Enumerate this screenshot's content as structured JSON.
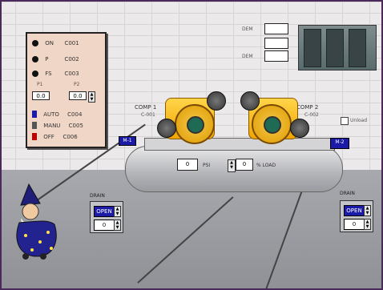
{
  "status_panel": {
    "indicators": [
      {
        "label": "ON",
        "value": "C001"
      },
      {
        "label": "P",
        "value": "C002"
      },
      {
        "label": "FS",
        "value": "C003"
      }
    ],
    "setpoint_labels": [
      "P1",
      "P2"
    ],
    "setpoint_values": [
      "0.0",
      "0.0"
    ],
    "modes": [
      {
        "label": "AUTO",
        "value": "C004"
      },
      {
        "label": "MANU",
        "value": "C005"
      },
      {
        "label": "OFF",
        "value": "C006"
      }
    ]
  },
  "top_fields": [
    {
      "label": "DEM",
      "value": ""
    },
    {
      "label": "",
      "value": ""
    },
    {
      "label": "DEM",
      "value": ""
    }
  ],
  "compressors": [
    {
      "label": "COMP 1",
      "sub": "C-001"
    },
    {
      "label": "COMP 2",
      "sub": "C-002"
    }
  ],
  "tank": {
    "pressure_label": "PSI",
    "pressure_value": "0",
    "level_label": "% LOAD",
    "level_value": "0"
  },
  "check_label": "Unload",
  "side_signs": [
    "M-1",
    "M-2"
  ],
  "valves": [
    {
      "title": "DRAIN",
      "top_value": "OPEN",
      "bottom_value": "0"
    },
    {
      "title": "DRAIN",
      "top_value": "OPEN",
      "bottom_value": "0"
    }
  ],
  "colors": {
    "wall": "#ebe9ea",
    "floor": "#9c9ea3",
    "accent_blue": "#1b1ba8",
    "compressor_yellow": "#f2a500"
  }
}
